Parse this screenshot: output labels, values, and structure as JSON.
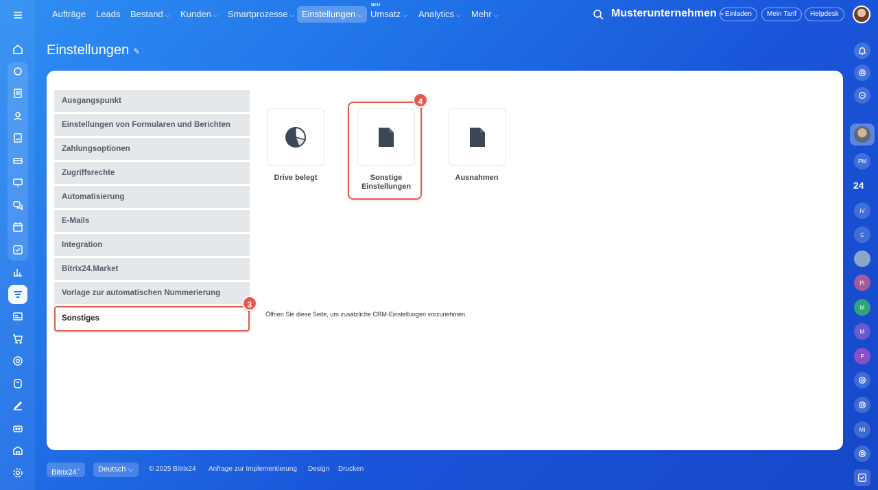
{
  "topnav": {
    "items": [
      {
        "label": "Aufträge",
        "chevron": false
      },
      {
        "label": "Leads",
        "chevron": false
      },
      {
        "label": "Bestand",
        "chevron": true
      },
      {
        "label": "Kunden",
        "chevron": true
      },
      {
        "label": "Smartprozesse",
        "chevron": true
      },
      {
        "label": "Einstellungen",
        "chevron": true,
        "active": true
      },
      {
        "label": "Umsatz",
        "chevron": true
      },
      {
        "label": "Analytics",
        "chevron": true
      },
      {
        "label": "Mehr",
        "chevron": true
      }
    ],
    "neu_badge": "NEU",
    "company": "Musterunternehmen",
    "invite": "Einladen",
    "plan": "Mein Tarif",
    "helpdesk": "Helpdesk"
  },
  "page": {
    "title": "Einstellungen"
  },
  "menu": {
    "items": [
      "Ausgangspunkt",
      "Einstellungen von Formularen und Berichten",
      "Zahlungsoptionen",
      "Zugriffsrechte",
      "Automatisierung",
      "E-Mails",
      "Integration",
      "Bitrix24.Market",
      "Vorlage zur automatischen Nummerierung",
      "Sonstiges"
    ],
    "selected": "Sonstiges"
  },
  "tiles": [
    {
      "label": "Drive belegt",
      "icon": "pie-chart-icon"
    },
    {
      "label": "Sonstige Einstellungen",
      "icon": "document-icon"
    },
    {
      "label": "Ausnahmen",
      "icon": "document-icon"
    }
  ],
  "description": "Öffnen Sie diese Seite, um zusätzliche CRM-Einstellungen vorzunehmen.",
  "steps": {
    "menu_step": "3",
    "tile_step": "4"
  },
  "footer": {
    "brand": "Bitrix24",
    "language": "Deutsch",
    "copyright": "© 2025 Bitrix24",
    "links": [
      "Anfrage zur Implementierung",
      "Design",
      "Drucken"
    ]
  },
  "right_bar": {
    "count": "24",
    "initials": [
      "PM",
      "IV",
      "C",
      "PI",
      "M",
      "M",
      "P",
      "MI"
    ]
  },
  "colors": {
    "accent": "#1f6fe6",
    "highlight": "#e05a4e",
    "menu_bg": "#e5e8eb"
  }
}
